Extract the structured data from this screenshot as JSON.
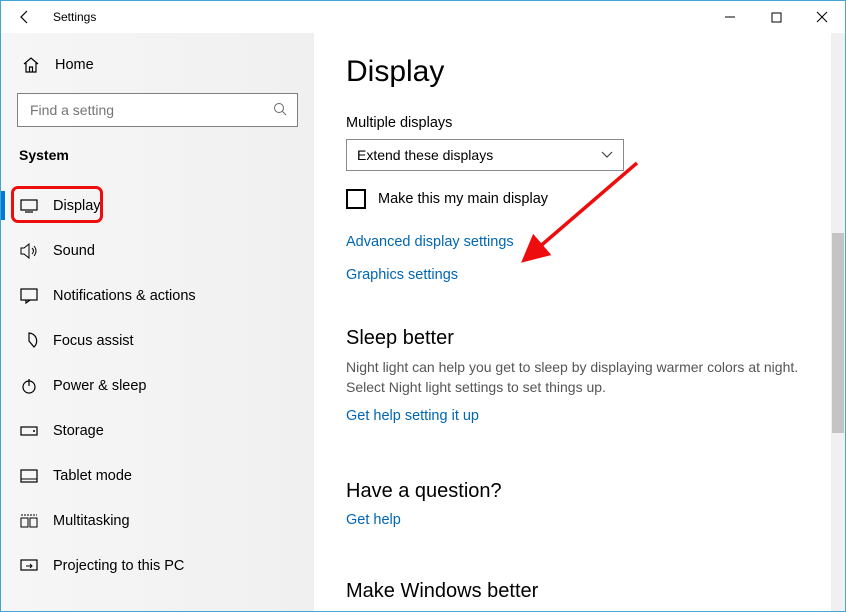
{
  "window": {
    "title": "Settings"
  },
  "sidebar": {
    "home_label": "Home",
    "search_placeholder": "Find a setting",
    "section_label": "System",
    "items": [
      {
        "label": "Display"
      },
      {
        "label": "Sound"
      },
      {
        "label": "Notifications & actions"
      },
      {
        "label": "Focus assist"
      },
      {
        "label": "Power & sleep"
      },
      {
        "label": "Storage"
      },
      {
        "label": "Tablet mode"
      },
      {
        "label": "Multitasking"
      },
      {
        "label": "Projecting to this PC"
      }
    ]
  },
  "main": {
    "title": "Display",
    "multiple_displays_label": "Multiple displays",
    "multiple_displays_value": "Extend these displays",
    "main_display_checkbox": "Make this my main display",
    "link_advanced": "Advanced display settings",
    "link_graphics": "Graphics settings",
    "sleep_title": "Sleep better",
    "sleep_desc": "Night light can help you get to sleep by displaying warmer colors at night. Select Night light settings to set things up.",
    "link_sleep_help": "Get help setting it up",
    "question_title": "Have a question?",
    "link_get_help": "Get help",
    "make_better_title": "Make Windows better"
  }
}
